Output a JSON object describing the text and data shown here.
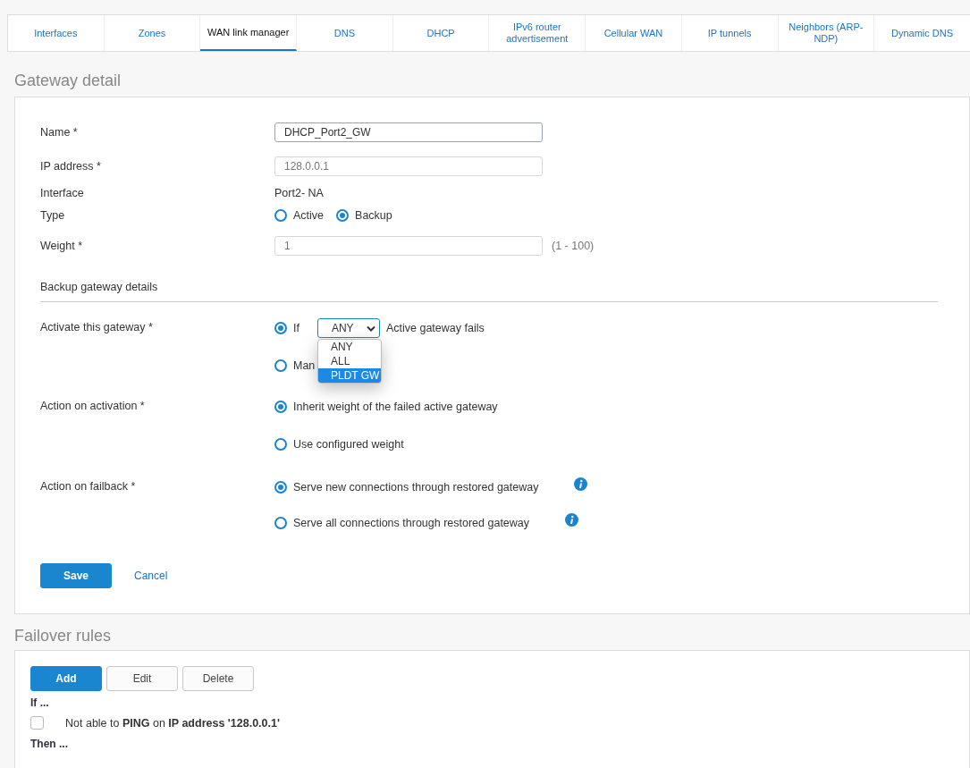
{
  "tabs": [
    {
      "label": "Interfaces",
      "selected": false
    },
    {
      "label": "Zones",
      "selected": false
    },
    {
      "label": "WAN link manager",
      "selected": true
    },
    {
      "label": "DNS",
      "selected": false
    },
    {
      "label": "DHCP",
      "selected": false
    },
    {
      "label": "IPv6 router advertisement",
      "selected": false
    },
    {
      "label": "Cellular WAN",
      "selected": false
    },
    {
      "label": "IP tunnels",
      "selected": false
    },
    {
      "label": "Neighbors (ARP-NDP)",
      "selected": false
    },
    {
      "label": "Dynamic DNS",
      "selected": false
    }
  ],
  "gateway_detail": {
    "title": "Gateway detail",
    "fields": [
      {
        "kind": "input",
        "label": "Name *",
        "value": "DHCP_Port2_GW",
        "disabled": false
      },
      {
        "kind": "input",
        "label": "IP address *",
        "value": "128.0.0.1",
        "disabled": true
      },
      {
        "kind": "static",
        "label": "Interface",
        "value": "Port2- NA"
      },
      {
        "kind": "radio_inline",
        "label": "Type",
        "options": [
          {
            "label": "Active",
            "selected": false
          },
          {
            "label": "Backup",
            "selected": true
          }
        ]
      },
      {
        "kind": "input",
        "label": "Weight *",
        "value": "1",
        "disabled": true,
        "hint": "(1 - 100)"
      }
    ],
    "section_title": "Backup gateway details",
    "backup_fields": [
      {
        "label": "Activate this gateway *",
        "options": [
          {
            "kind": "select",
            "label": "If",
            "selected": true,
            "select": {
              "value": "ANY",
              "expanded": true,
              "options": [
                {
                  "label": "ANY",
                  "highlighted": false
                },
                {
                  "label": "ALL",
                  "highlighted": false
                },
                {
                  "label": "PLDT GW",
                  "highlighted": true
                }
              ]
            },
            "suffix": "Active gateway fails"
          },
          {
            "kind": "plain",
            "label": "Man",
            "selected": false
          }
        ]
      },
      {
        "label": "Action on activation *",
        "options": [
          {
            "kind": "plain",
            "label": "Inherit weight of the failed active gateway",
            "selected": true
          },
          {
            "kind": "plain",
            "label": "Use configured weight",
            "selected": false
          }
        ]
      },
      {
        "label": "Action on failback *",
        "options": [
          {
            "kind": "info",
            "label": "Serve new connections through restored gateway",
            "selected": true
          },
          {
            "kind": "info",
            "label": "Serve all connections through restored gateway",
            "selected": false
          }
        ]
      }
    ],
    "buttons": [
      {
        "kind": "primary",
        "label": "Save"
      },
      {
        "kind": "link",
        "label": "Cancel"
      }
    ]
  },
  "failover_rules": {
    "title": "Failover rules",
    "buttons": [
      {
        "kind": "primary",
        "label": "Add"
      },
      {
        "kind": "secondary",
        "label": "Edit"
      },
      {
        "kind": "secondary",
        "label": "Delete"
      }
    ],
    "if_label": "If ...",
    "conditions": [
      {
        "text": "Not able to **PING** on **IP address '128.0.0.1'**",
        "checked": false
      }
    ],
    "then_label": "Then ..."
  }
}
